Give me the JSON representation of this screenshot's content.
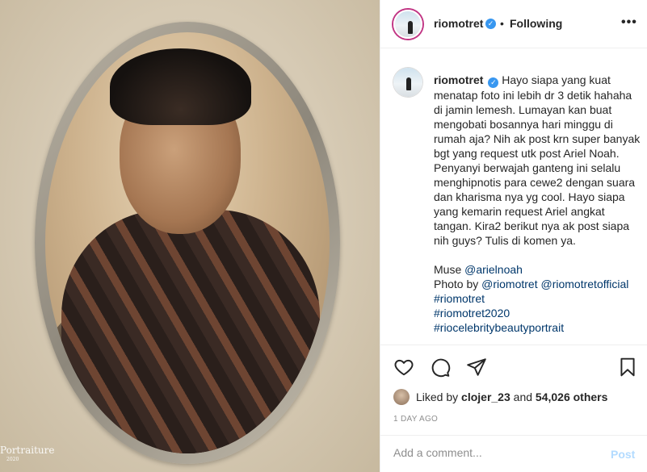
{
  "photo": {
    "watermark_title": "Portraiture",
    "watermark_year": "2020"
  },
  "header": {
    "username": "riomotret",
    "verified_icon": "verified-badge-icon",
    "separator": "•",
    "follow_status": "Following",
    "more_label": "•••"
  },
  "caption": {
    "username": "riomotret",
    "body": "Hayo siapa yang kuat menatap foto ini lebih dr 3 detik hahaha di jamin lemesh. Lumayan kan buat mengobati bosannya hari minggu di rumah aja? Nih ak post krn super banyak bgt yang request utk post Ariel Noah. Penyanyi berwajah ganteng ini selalu menghipnotis para cewe2 dengan suara dan kharisma nya yg cool. Hayo siapa yang kemarin request Ariel angkat tangan. Kira2 berikut nya ak post siapa nih guys? Tulis di komen ya.",
    "muse_label": "Muse",
    "muse_link": "@arielnoah",
    "photo_by_label": "Photo by",
    "photo_by_link1": "@riomotret",
    "photo_by_link2": "@riomotretofficial",
    "hashtag1": "#riomotret",
    "hashtag2": "#riomotret2020",
    "hashtag3": "#riocelebritybeautyportrait"
  },
  "actions": {
    "like_icon": "heart-icon",
    "comment_icon": "comment-icon",
    "share_icon": "share-icon",
    "save_icon": "bookmark-icon"
  },
  "likes": {
    "prefix": "Liked by",
    "user": "clojer_23",
    "conjunction": "and",
    "count": "54,026 others"
  },
  "timestamp": "1 DAY AGO",
  "comment": {
    "placeholder": "Add a comment...",
    "post_label": "Post"
  },
  "colors": {
    "link": "#00376b",
    "verified": "#3897f0",
    "post_disabled": "#b3dbff",
    "muted": "#8e8e8e"
  }
}
